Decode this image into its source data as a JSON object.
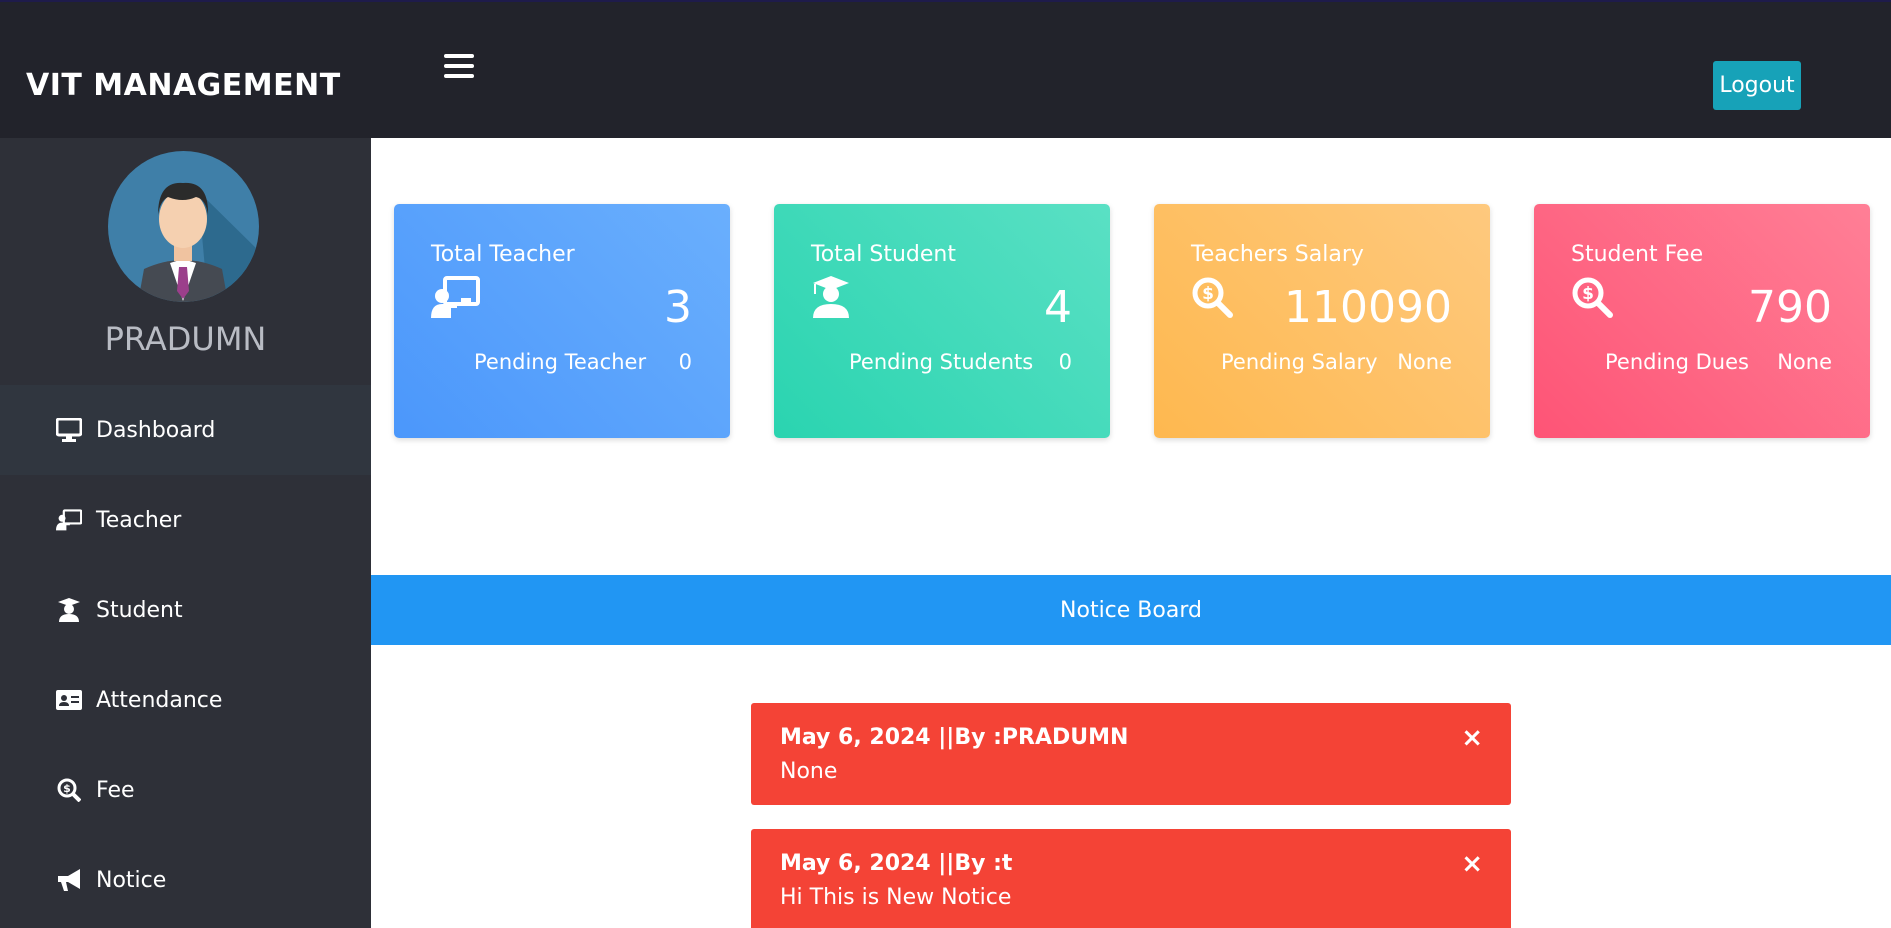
{
  "header": {
    "brand": "VIT MANAGEMENT",
    "menu_icon": "hamburger-menu-icon",
    "logout_label": "Logout",
    "logout_color": "#17a2b8"
  },
  "sidebar": {
    "user_name": "PRADUMN",
    "avatar_icon": "user-avatar",
    "items": [
      {
        "label": "Dashboard",
        "icon": "monitor-icon",
        "active": true
      },
      {
        "label": "Teacher",
        "icon": "chalkboard-teacher-icon",
        "active": false
      },
      {
        "label": "Student",
        "icon": "user-graduate-icon",
        "active": false
      },
      {
        "label": "Attendance",
        "icon": "id-card-icon",
        "active": false
      },
      {
        "label": "Fee",
        "icon": "search-dollar-icon",
        "active": false
      },
      {
        "label": "Notice",
        "icon": "bullhorn-icon",
        "active": false
      }
    ]
  },
  "cards": [
    {
      "title": "Total Teacher",
      "icon": "chalkboard-teacher-icon",
      "value": "3",
      "pending_label": "Pending Teacher",
      "pending_value": "0",
      "color": "#4b97fb"
    },
    {
      "title": "Total Student",
      "icon": "user-graduate-icon",
      "value": "4",
      "pending_label": "Pending Students",
      "pending_value": "0",
      "color": "#2ad4b0"
    },
    {
      "title": "Teachers Salary",
      "icon": "search-dollar-icon",
      "value": "110090",
      "pending_label": "Pending Salary",
      "pending_value": "None",
      "color": "#feb84f"
    },
    {
      "title": "Student Fee",
      "icon": "search-dollar-icon",
      "value": "790",
      "pending_label": "Pending Dues",
      "pending_value": "None",
      "color": "#fe5476"
    }
  ],
  "notice_board": {
    "title": "Notice Board",
    "header_color": "#2196f3",
    "notice_color": "#f44336",
    "close_symbol": "×",
    "notices": [
      {
        "meta": "May 6, 2024 ||By :PRADUMN",
        "text": "None"
      },
      {
        "meta": "May 6, 2024 ||By :t",
        "text": "Hi This is New Notice"
      }
    ]
  }
}
